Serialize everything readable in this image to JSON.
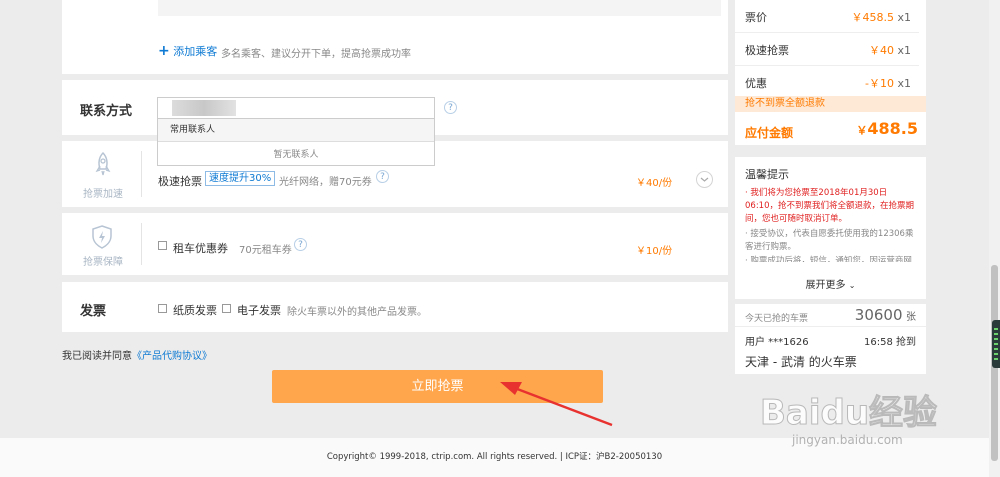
{
  "passenger": {
    "add_label": "添加乘客",
    "hint": "多名乘客、建议分开下单，提高抢票成功率"
  },
  "contact": {
    "title": "联系方式",
    "dropdown_header": "常用联系人",
    "dropdown_empty": "暂无联系人"
  },
  "speed": {
    "side_label": "抢票加速",
    "name": "极速抢票",
    "badge": "速度提升30%",
    "desc": "光纤网络，赠70元券",
    "price": "￥40/份"
  },
  "guarantee": {
    "side_label": "抢票保障",
    "name": "租车优惠券",
    "desc": "70元租车券",
    "price": "￥10/份"
  },
  "invoice": {
    "title": "发票",
    "paper": "纸质发票",
    "electronic": "电子发票",
    "note": "除火车票以外的其他产品发票。"
  },
  "agreement": {
    "prefix": "我已阅读并同意",
    "link": "《产品代购协议》"
  },
  "submit_label": "立即抢票",
  "footer": "Copyright© 1999-2018, ctrip.com. All rights reserved. | ICP证：沪B2-20050130",
  "summary": {
    "rows": [
      {
        "label": "票价",
        "value": "￥458.5",
        "qty": "x1"
      },
      {
        "label": "极速抢票",
        "value": "￥40",
        "qty": "x1"
      },
      {
        "label": "优惠",
        "value": "-￥10",
        "qty": "x1"
      }
    ],
    "refund_note": "抢不到票全额退款",
    "total_label": "应付金额",
    "total_currency": "￥",
    "total_value": "488.5"
  },
  "tips": {
    "title": "温馨提示",
    "red_text": "· 我们将为您抢票至2018年01月30日 06:10，抢不到票我们将全额退款，在抢票期间，您也可随时取消订单。",
    "gray_text": "· 接受协议，代表自愿委托使用我的12306乘客进行购票。",
    "gray_text2": "· 购票成功后将，短信，通知您，因运营商网",
    "more": "展开更多"
  },
  "stats": {
    "label": "今天已抢的车票",
    "count": "30600",
    "unit": "张",
    "user": "用户 ***1626",
    "time": "16:58 抢到",
    "route": "天津 - 武清 的火车票"
  },
  "watermark": {
    "brand": "Baidu经验",
    "url": "jingyan.baidu.com"
  },
  "colors": {
    "accent": "#ff7a00",
    "button": "#ffa64d",
    "link": "#0e7ad3",
    "warning_bg": "#fde9d5"
  }
}
